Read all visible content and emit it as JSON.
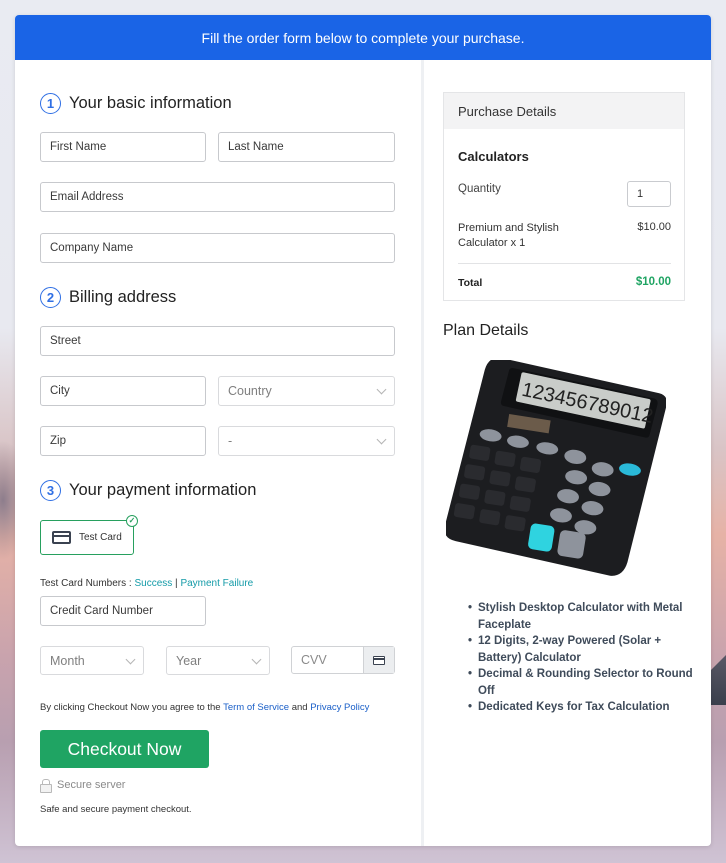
{
  "banner": {
    "text": "Fill the order form below to complete your purchase."
  },
  "sections": {
    "basic": {
      "num": "1",
      "title": "Your basic information"
    },
    "billing": {
      "num": "2",
      "title": "Billing address"
    },
    "payment": {
      "num": "3",
      "title": "Your payment information"
    }
  },
  "basic_fields": {
    "first_name": {
      "placeholder": "First Name",
      "value": ""
    },
    "last_name": {
      "placeholder": "Last Name",
      "value": ""
    },
    "email": {
      "placeholder": "Email Address",
      "value": ""
    },
    "company": {
      "placeholder": "Company Name",
      "value": ""
    }
  },
  "billing_fields": {
    "street": {
      "placeholder": "Street",
      "value": ""
    },
    "city": {
      "placeholder": "City",
      "value": ""
    },
    "country": {
      "selected": "Country"
    },
    "zip": {
      "placeholder": "Zip",
      "value": ""
    },
    "state": {
      "selected": "-"
    }
  },
  "payment": {
    "method": {
      "label": "Test Card",
      "icon": "credit-card-icon",
      "selected": true
    },
    "test_numbers_label": "Test Card Numbers : ",
    "success_link": "Success",
    "separator": " | ",
    "failure_link": "Payment Failure",
    "card_number": {
      "placeholder": "Credit Card Number",
      "value": ""
    },
    "month": {
      "selected": "Month"
    },
    "year": {
      "selected": "Year"
    },
    "cvv": {
      "placeholder": "CVV",
      "value": ""
    }
  },
  "terms": {
    "prefix": "By clicking Checkout Now you agree to the ",
    "tos_link": "Term of Service",
    "and": " and ",
    "privacy_link": "Privacy Policy"
  },
  "checkout": {
    "button_label": "Checkout Now",
    "secure_label": "Secure server",
    "safe_text": "Safe and secure payment checkout."
  },
  "purchase": {
    "header": "Purchase Details",
    "product": "Calculators",
    "quantity_label": "Quantity",
    "quantity_value": "1",
    "item_desc": "Premium and Stylish Calculator x 1",
    "item_price": "$10.00",
    "total_label": "Total",
    "total_value": "$10.00"
  },
  "plan": {
    "title": "Plan Details",
    "image_alt": "calculator-image",
    "display_digits": "123456789012",
    "features": [
      "Stylish Desktop Calculator with Metal Faceplate",
      "12 Digits, 2-way Powered (Solar + Battery) Calculator",
      "Decimal & Rounding Selector to Round Off",
      "Dedicated Keys for Tax Calculation"
    ]
  },
  "colors": {
    "brand_blue": "#1a64e6",
    "success_green": "#1fa463",
    "link_teal": "#149ba8",
    "link_blue": "#1a5fc8"
  }
}
